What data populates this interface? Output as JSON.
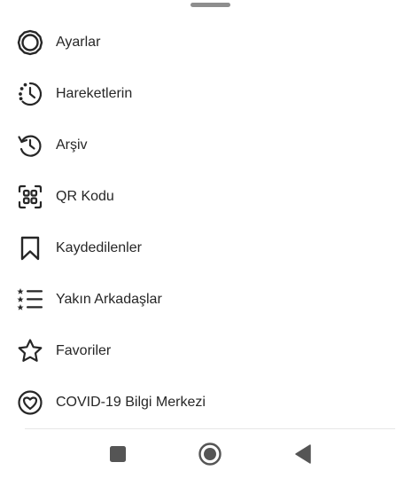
{
  "menu": {
    "items": [
      {
        "label": "Ayarlar",
        "icon": "settings-gear-icon"
      },
      {
        "label": "Hareketlerin",
        "icon": "activity-clock-icon"
      },
      {
        "label": "Arşiv",
        "icon": "archive-history-icon"
      },
      {
        "label": "QR Kodu",
        "icon": "qr-code-icon"
      },
      {
        "label": "Kaydedilenler",
        "icon": "bookmark-icon"
      },
      {
        "label": "Yakın Arkadaşlar",
        "icon": "close-friends-list-icon"
      },
      {
        "label": "Favoriler",
        "icon": "star-icon"
      },
      {
        "label": "COVID-19 Bilgi Merkezi",
        "icon": "covid-heart-icon"
      }
    ]
  },
  "navigation_bar": {
    "buttons": [
      "recents-square-icon",
      "home-circle-icon",
      "back-triangle-icon"
    ]
  },
  "colors": {
    "text": "#262626",
    "icon": "#262626",
    "handle": "#8e8e8e",
    "nav_icons": "#555555",
    "background": "#ffffff"
  }
}
